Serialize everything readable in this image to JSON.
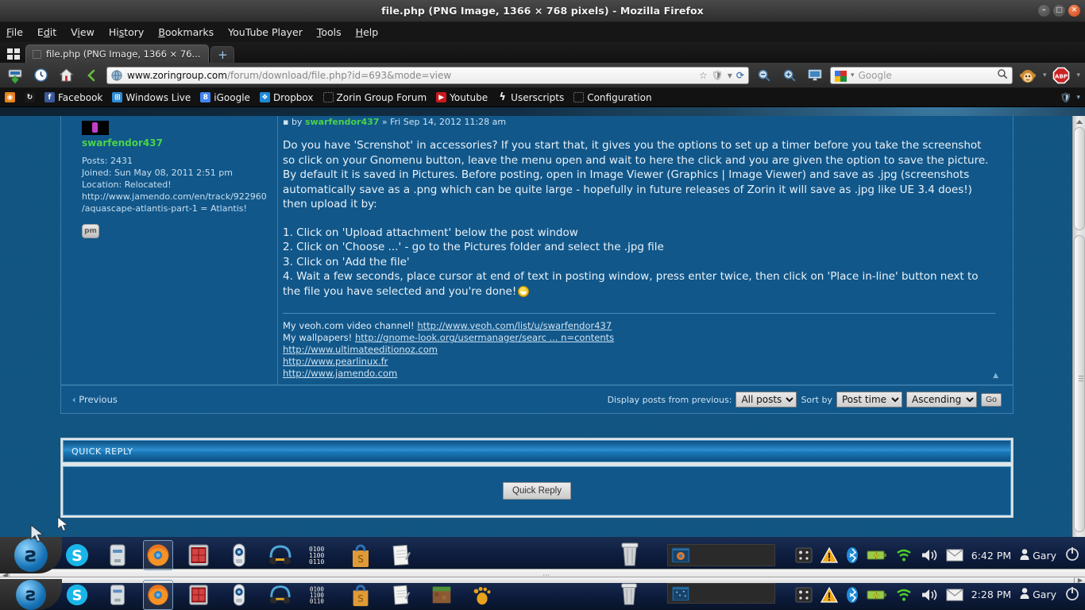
{
  "window": {
    "title": "file.php (PNG Image, 1366 × 768 pixels) - Mozilla Firefox",
    "min_label": "–",
    "max_label": "□",
    "close_label": "✕"
  },
  "menubar": {
    "items": [
      "File",
      "Edit",
      "View",
      "History",
      "Bookmarks",
      "YouTube Player",
      "Tools",
      "Help"
    ]
  },
  "tabs": {
    "active_label": "file.php (PNG Image, 1366 × 76...",
    "newtab_label": "+"
  },
  "navbar": {
    "url_domain": "www.zoringroup.com",
    "url_path": "/forum/download/file.php?id=693&mode=view",
    "search_placeholder": "Google",
    "search_engine": "Google",
    "back_icon": "back-arrow-icon",
    "reload_icon": "reload-icon",
    "star_icon": "bookmark-star-icon",
    "zoom_out_icon": "zoom-out-icon",
    "zoom_in_icon": "zoom-in-icon"
  },
  "bookmarks": {
    "items": [
      {
        "label": "",
        "icon": "rss-icon",
        "color": "#e8821a"
      },
      {
        "label": "",
        "icon": "sync-icon",
        "color": "#ffffff"
      },
      {
        "label": "Facebook",
        "icon": "facebook-icon",
        "color": "#3b5998"
      },
      {
        "label": "Windows Live",
        "icon": "windows-icon",
        "color": "#2d8bd8"
      },
      {
        "label": "iGoogle",
        "icon": "igoogle-icon",
        "color": "#4285f4"
      },
      {
        "label": "Dropbox",
        "icon": "dropbox-icon",
        "color": "#1e8ad6"
      },
      {
        "label": "Zorin Group Forum",
        "icon": "generic-page-icon",
        "color": "#888888"
      },
      {
        "label": "Youtube",
        "icon": "youtube-icon",
        "color": "#cc181e"
      },
      {
        "label": "Userscripts",
        "icon": "userscripts-icon",
        "color": "#dddddd"
      },
      {
        "label": "Configuration",
        "icon": "generic-page-icon",
        "color": "#888888"
      }
    ]
  },
  "post": {
    "header_prefix": "by",
    "author": "swarfendor437",
    "date": "» Fri Sep 14, 2012 11:28 am",
    "profile": {
      "username": "swarfendor437",
      "posts_label": "Posts: 2431",
      "joined_label": "Joined: Sun May 08, 2011 2:51 pm",
      "location_label": "Location: Relocated! http://www.jamendo.com/en/track/922960/aquascape-atlantis-part-1 = Atlantis!",
      "pm_button": "pm"
    },
    "paragraph": "Do you have 'Screnshot' in accessories? If you start that, it gives you the options to set up a timer before you take the screenshot so click on your Gnomenu button, leave the menu open and wait to here the click and you are given the option to save the picture. By default it is saved in Pictures. Before posting, open in Image Viewer (Graphics | Image Viewer) and save as .jpg (screenshots automatically save as a .png which can be quite large - hopefully in future releases of Zorin it will save as .jpg like UE 3.4 does!) then upload it by:",
    "steps": [
      "1. Click on 'Upload attachment' below the post window",
      "2. Click on 'Choose ...' - go to the Pictures folder and select the .jpg file",
      "3. Click on 'Add the file'",
      "4. Wait a few seconds, place cursor at end of text in posting window, press enter twice, then click on 'Place in-line' button next to the file you have selected and you're done!"
    ],
    "signature": {
      "line1_text": "My veoh.com video channel! ",
      "line1_link": "http://www.veoh.com/list/u/swarfendor437",
      "line2_text": "My wallpapers! ",
      "line2_link": "http://gnome-look.org/usermanager/searc ... n=contents",
      "line3_link": "http://www.ultimateeditionoz.com",
      "line4_link": "http://www.pearlinux.fr",
      "line5_link": "http://www.jamendo.com"
    }
  },
  "controls": {
    "previous_label": "‹ Previous",
    "display_label": "Display posts from previous:",
    "display_value": "All posts",
    "display_options": [
      "All posts"
    ],
    "sortby_label": "Sort by",
    "sortby_value": "Post time",
    "sortby_options": [
      "Post time"
    ],
    "order_value": "Ascending",
    "order_options": [
      "Ascending"
    ],
    "go_label": "Go"
  },
  "quick_reply": {
    "panel_title": "QUICK REPLY",
    "button_label": "Quick Reply"
  },
  "taskbar_top": {
    "clock": "6:42 PM",
    "user": "Gary",
    "launchers": [
      "skype-icon",
      "archive-manager-icon",
      "firefox-icon",
      "calculator-icon",
      "media-player-icon",
      "audio-icon",
      "terminal-icon",
      "software-center-icon",
      "text-editor-icon"
    ],
    "window_button": "firefox-window-button",
    "tray": [
      "media-applet-icon",
      "warning-icon",
      "bluetooth-icon",
      "battery-icon",
      "wifi-icon",
      "volume-icon",
      "mail-icon"
    ],
    "trash_icon": "trash-icon",
    "power_icon": "power-icon"
  },
  "taskbar_bottom": {
    "clock": "2:28 PM",
    "user": "Gary",
    "launchers": [
      "skype-icon",
      "archive-manager-icon",
      "firefox-icon",
      "calculator-icon",
      "media-player-icon",
      "audio-icon",
      "terminal-icon",
      "software-center-icon",
      "text-editor-icon",
      "minecraft-icon",
      "gnome-icon"
    ],
    "window_button": "firefox-window-button",
    "tray": [
      "media-applet-icon",
      "warning-icon",
      "bluetooth-icon",
      "battery-icon",
      "wifi-icon",
      "volume-icon",
      "mail-icon"
    ],
    "trash_icon": "trash-icon",
    "power_icon": "power-icon"
  }
}
